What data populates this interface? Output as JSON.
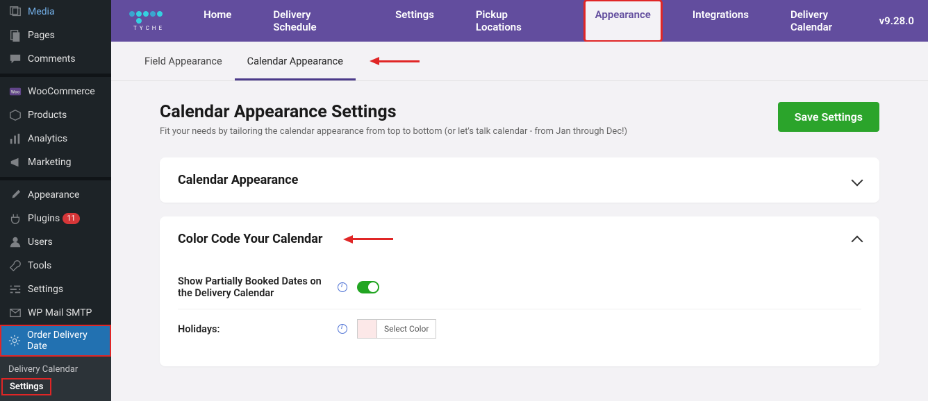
{
  "wp_sidebar": {
    "items": [
      {
        "label": "Media"
      },
      {
        "label": "Pages"
      },
      {
        "label": "Comments"
      },
      {
        "label": "WooCommerce"
      },
      {
        "label": "Products"
      },
      {
        "label": "Analytics"
      },
      {
        "label": "Marketing"
      },
      {
        "label": "Appearance"
      },
      {
        "label": "Plugins",
        "badge": "11"
      },
      {
        "label": "Users"
      },
      {
        "label": "Tools"
      },
      {
        "label": "Settings"
      },
      {
        "label": "WP Mail SMTP"
      },
      {
        "label": "Order Delivery Date"
      }
    ],
    "submenu": [
      {
        "label": "Delivery Calendar"
      },
      {
        "label": "Settings"
      }
    ]
  },
  "brand": {
    "name": "TYCHE"
  },
  "nav": {
    "links": [
      "Home",
      "Delivery Schedule",
      "Settings",
      "Pickup Locations",
      "Appearance",
      "Integrations",
      "Delivery Calendar"
    ],
    "version": "v9.28.0"
  },
  "tabs": {
    "field": "Field Appearance",
    "calendar": "Calendar Appearance"
  },
  "page": {
    "title": "Calendar Appearance Settings",
    "desc": "Fit your needs by tailoring the calendar appearance from top to bottom (or let's talk calendar - from Jan through Dec!)",
    "save": "Save Settings"
  },
  "panels": {
    "appearance": {
      "title": "Calendar Appearance"
    },
    "color": {
      "title": "Color Code Your Calendar",
      "partial": "Show Partially Booked Dates on the Delivery Calendar",
      "holidays": "Holidays:",
      "select_color": "Select Color",
      "swatch_color": "#fce8e8"
    }
  }
}
